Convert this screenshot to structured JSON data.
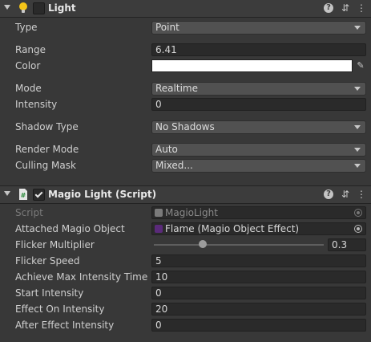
{
  "light": {
    "title": "Light",
    "type": {
      "label": "Type",
      "value": "Point"
    },
    "range": {
      "label": "Range",
      "value": "6.41"
    },
    "color": {
      "label": "Color",
      "value": "#ffffff"
    },
    "mode": {
      "label": "Mode",
      "value": "Realtime"
    },
    "intensity": {
      "label": "Intensity",
      "value": "0"
    },
    "shadow_type": {
      "label": "Shadow Type",
      "value": "No Shadows"
    },
    "render_mode": {
      "label": "Render Mode",
      "value": "Auto"
    },
    "culling_mask": {
      "label": "Culling Mask",
      "value": "Mixed..."
    }
  },
  "magio": {
    "title": "Magio Light (Script)",
    "script": {
      "label": "Script",
      "value": "MagioLight"
    },
    "attached": {
      "label": "Attached Magio Object",
      "value": "Flame (Magio Object Effect)"
    },
    "flicker_multiplier": {
      "label": "Flicker Multiplier",
      "value": "0.3",
      "fraction": 0.29
    },
    "flicker_speed": {
      "label": "Flicker Speed",
      "value": "5"
    },
    "max_intensity_time": {
      "label": "Achieve Max Intensity Time",
      "value": "10"
    },
    "start_intensity": {
      "label": "Start Intensity",
      "value": "0"
    },
    "effect_on_intensity": {
      "label": "Effect On Intensity",
      "value": "20"
    },
    "after_effect_intensity": {
      "label": "After Effect Intensity",
      "value": "0"
    }
  },
  "header_icons": {
    "help": "?",
    "presets": "⇵",
    "menu": "⋮"
  },
  "colors": {
    "background": "#383838",
    "header": "#3c3c3c",
    "light_icon": "#f5c518",
    "object_icon": "#5a2a7a"
  }
}
